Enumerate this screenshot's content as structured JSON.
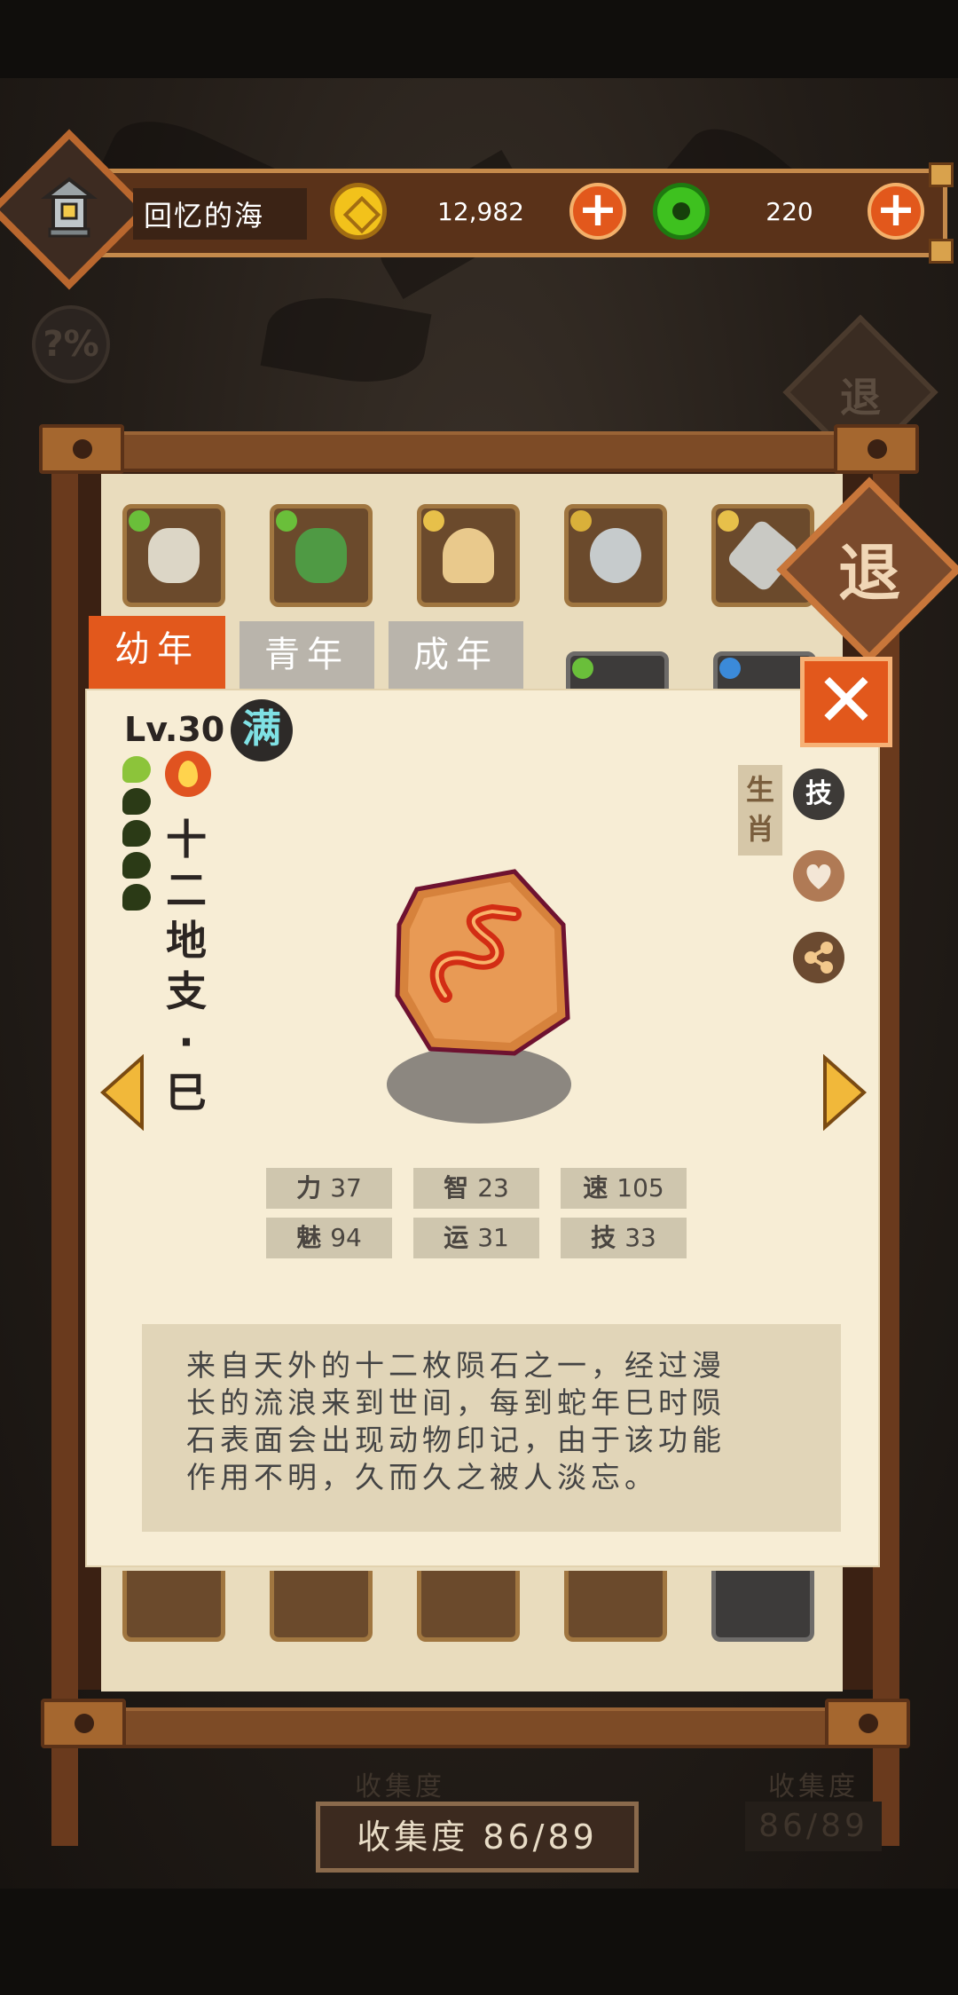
{
  "header": {
    "player_name": "回忆的海",
    "coins": "12,982",
    "gems": "220"
  },
  "exit_label": "退",
  "tabs": [
    "幼年",
    "青年",
    "成年"
  ],
  "card": {
    "level": "Lv.30",
    "full_badge": "满",
    "name_chars": [
      "十",
      "二",
      "地",
      "支",
      "·",
      "巳"
    ],
    "category_tag_chars": [
      "生",
      "肖"
    ],
    "skill_icon_label": "技",
    "stats": [
      {
        "label": "力",
        "value": "37"
      },
      {
        "label": "智",
        "value": "23"
      },
      {
        "label": "速",
        "value": "105"
      },
      {
        "label": "魅",
        "value": "94"
      },
      {
        "label": "运",
        "value": "31"
      },
      {
        "label": "技",
        "value": "33"
      }
    ],
    "description_lines": [
      "来自天外的十二枚陨石之一，经过漫",
      "长的流浪来到世间，每到蛇年巳时陨",
      "石表面会出现动物印记，由于该功能",
      "作用不明，久而久之被人淡忘。"
    ]
  },
  "collection": {
    "label": "收集度",
    "value": "86/89",
    "display": "收集度 86/89"
  },
  "colors": {
    "accent_orange": "#e2581c",
    "tab_active": "#e2581c",
    "tab_inactive": "#b9b4ab",
    "paper": "#f7edd5",
    "wood": "#7d4b26",
    "coin_gold": "#f2c21b",
    "gem_green": "#3ec11f"
  }
}
